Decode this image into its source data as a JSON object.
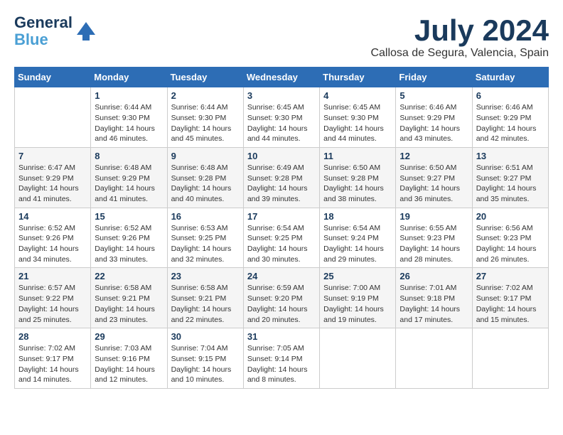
{
  "header": {
    "logo_line1": "General",
    "logo_line2": "Blue",
    "month": "July 2024",
    "location": "Callosa de Segura, Valencia, Spain"
  },
  "weekdays": [
    "Sunday",
    "Monday",
    "Tuesday",
    "Wednesday",
    "Thursday",
    "Friday",
    "Saturday"
  ],
  "weeks": [
    [
      {
        "day": "",
        "info": ""
      },
      {
        "day": "1",
        "info": "Sunrise: 6:44 AM\nSunset: 9:30 PM\nDaylight: 14 hours\nand 46 minutes."
      },
      {
        "day": "2",
        "info": "Sunrise: 6:44 AM\nSunset: 9:30 PM\nDaylight: 14 hours\nand 45 minutes."
      },
      {
        "day": "3",
        "info": "Sunrise: 6:45 AM\nSunset: 9:30 PM\nDaylight: 14 hours\nand 44 minutes."
      },
      {
        "day": "4",
        "info": "Sunrise: 6:45 AM\nSunset: 9:30 PM\nDaylight: 14 hours\nand 44 minutes."
      },
      {
        "day": "5",
        "info": "Sunrise: 6:46 AM\nSunset: 9:29 PM\nDaylight: 14 hours\nand 43 minutes."
      },
      {
        "day": "6",
        "info": "Sunrise: 6:46 AM\nSunset: 9:29 PM\nDaylight: 14 hours\nand 42 minutes."
      }
    ],
    [
      {
        "day": "7",
        "info": "Sunrise: 6:47 AM\nSunset: 9:29 PM\nDaylight: 14 hours\nand 41 minutes."
      },
      {
        "day": "8",
        "info": "Sunrise: 6:48 AM\nSunset: 9:29 PM\nDaylight: 14 hours\nand 41 minutes."
      },
      {
        "day": "9",
        "info": "Sunrise: 6:48 AM\nSunset: 9:28 PM\nDaylight: 14 hours\nand 40 minutes."
      },
      {
        "day": "10",
        "info": "Sunrise: 6:49 AM\nSunset: 9:28 PM\nDaylight: 14 hours\nand 39 minutes."
      },
      {
        "day": "11",
        "info": "Sunrise: 6:50 AM\nSunset: 9:28 PM\nDaylight: 14 hours\nand 38 minutes."
      },
      {
        "day": "12",
        "info": "Sunrise: 6:50 AM\nSunset: 9:27 PM\nDaylight: 14 hours\nand 36 minutes."
      },
      {
        "day": "13",
        "info": "Sunrise: 6:51 AM\nSunset: 9:27 PM\nDaylight: 14 hours\nand 35 minutes."
      }
    ],
    [
      {
        "day": "14",
        "info": "Sunrise: 6:52 AM\nSunset: 9:26 PM\nDaylight: 14 hours\nand 34 minutes."
      },
      {
        "day": "15",
        "info": "Sunrise: 6:52 AM\nSunset: 9:26 PM\nDaylight: 14 hours\nand 33 minutes."
      },
      {
        "day": "16",
        "info": "Sunrise: 6:53 AM\nSunset: 9:25 PM\nDaylight: 14 hours\nand 32 minutes."
      },
      {
        "day": "17",
        "info": "Sunrise: 6:54 AM\nSunset: 9:25 PM\nDaylight: 14 hours\nand 30 minutes."
      },
      {
        "day": "18",
        "info": "Sunrise: 6:54 AM\nSunset: 9:24 PM\nDaylight: 14 hours\nand 29 minutes."
      },
      {
        "day": "19",
        "info": "Sunrise: 6:55 AM\nSunset: 9:23 PM\nDaylight: 14 hours\nand 28 minutes."
      },
      {
        "day": "20",
        "info": "Sunrise: 6:56 AM\nSunset: 9:23 PM\nDaylight: 14 hours\nand 26 minutes."
      }
    ],
    [
      {
        "day": "21",
        "info": "Sunrise: 6:57 AM\nSunset: 9:22 PM\nDaylight: 14 hours\nand 25 minutes."
      },
      {
        "day": "22",
        "info": "Sunrise: 6:58 AM\nSunset: 9:21 PM\nDaylight: 14 hours\nand 23 minutes."
      },
      {
        "day": "23",
        "info": "Sunrise: 6:58 AM\nSunset: 9:21 PM\nDaylight: 14 hours\nand 22 minutes."
      },
      {
        "day": "24",
        "info": "Sunrise: 6:59 AM\nSunset: 9:20 PM\nDaylight: 14 hours\nand 20 minutes."
      },
      {
        "day": "25",
        "info": "Sunrise: 7:00 AM\nSunset: 9:19 PM\nDaylight: 14 hours\nand 19 minutes."
      },
      {
        "day": "26",
        "info": "Sunrise: 7:01 AM\nSunset: 9:18 PM\nDaylight: 14 hours\nand 17 minutes."
      },
      {
        "day": "27",
        "info": "Sunrise: 7:02 AM\nSunset: 9:17 PM\nDaylight: 14 hours\nand 15 minutes."
      }
    ],
    [
      {
        "day": "28",
        "info": "Sunrise: 7:02 AM\nSunset: 9:17 PM\nDaylight: 14 hours\nand 14 minutes."
      },
      {
        "day": "29",
        "info": "Sunrise: 7:03 AM\nSunset: 9:16 PM\nDaylight: 14 hours\nand 12 minutes."
      },
      {
        "day": "30",
        "info": "Sunrise: 7:04 AM\nSunset: 9:15 PM\nDaylight: 14 hours\nand 10 minutes."
      },
      {
        "day": "31",
        "info": "Sunrise: 7:05 AM\nSunset: 9:14 PM\nDaylight: 14 hours\nand 8 minutes."
      },
      {
        "day": "",
        "info": ""
      },
      {
        "day": "",
        "info": ""
      },
      {
        "day": "",
        "info": ""
      }
    ]
  ]
}
